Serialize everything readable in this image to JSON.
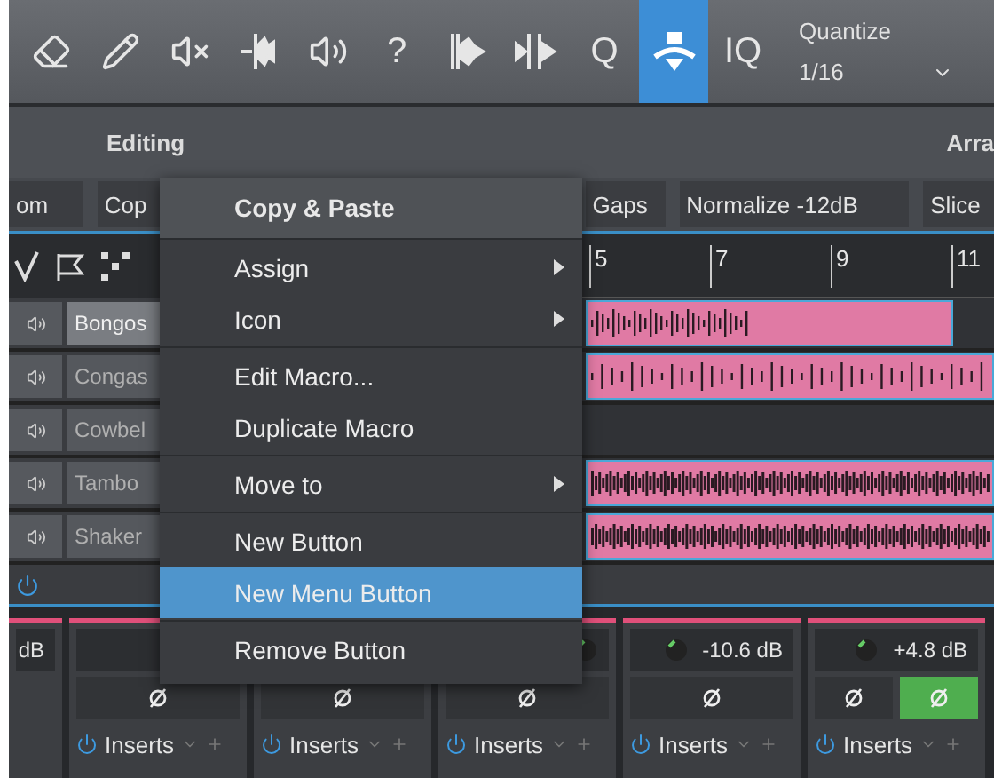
{
  "toolbar": {
    "tools": [
      {
        "kind": "eraser",
        "selected": false
      },
      {
        "kind": "pencil",
        "selected": false
      },
      {
        "kind": "mute",
        "selected": false
      },
      {
        "kind": "split",
        "selected": false
      },
      {
        "kind": "speaker",
        "selected": false
      },
      {
        "kind": "text",
        "label": "?",
        "selected": false
      },
      {
        "kind": "bend",
        "selected": false
      },
      {
        "kind": "stretch",
        "selected": false
      },
      {
        "kind": "text",
        "label": "Q",
        "selected": false
      },
      {
        "kind": "macro",
        "selected": true
      },
      {
        "kind": "text",
        "label": "IQ",
        "selected": false
      }
    ],
    "quantize": {
      "label": "Quantize",
      "value": "1/16"
    }
  },
  "editing": {
    "title": "Editing",
    "right_title": "Arra"
  },
  "macros": [
    "om",
    "Cop",
    "Gaps",
    "Normalize -12dB",
    "Slice"
  ],
  "ruler": {
    "marks": [
      "5",
      "7",
      "9",
      "11"
    ]
  },
  "tracks": [
    {
      "name": "Bongos",
      "selected": true,
      "kind": "short"
    },
    {
      "name": "Congas",
      "selected": false,
      "kind": "sparse"
    },
    {
      "name": "Cowbel",
      "selected": false,
      "kind": "empty"
    },
    {
      "name": "Tambo",
      "selected": false,
      "kind": "dense"
    },
    {
      "name": "Shaker",
      "selected": false,
      "kind": "dense"
    }
  ],
  "mixer": [
    {
      "kind": "partial",
      "value": "dB"
    },
    {
      "kind": "full",
      "phase": [
        {
          "on": false
        }
      ],
      "inserts": "Inserts"
    },
    {
      "kind": "full",
      "phase": [
        {
          "on": false
        }
      ],
      "inserts": "Inserts"
    },
    {
      "kind": "full",
      "phase": [
        {
          "on": false
        }
      ],
      "inserts": "Inserts"
    },
    {
      "kind": "full",
      "value": "-10.6 dB",
      "phase": [
        {
          "on": false
        }
      ],
      "inserts": "Inserts"
    },
    {
      "kind": "full",
      "value": "+4.8 dB",
      "phase": [
        {
          "on": false
        },
        {
          "on": true
        }
      ],
      "inserts": "Inserts"
    }
  ],
  "context_menu": {
    "title": "Copy & Paste",
    "groups": [
      [
        {
          "label": "Assign",
          "submenu": true,
          "selected": false
        },
        {
          "label": "Icon",
          "submenu": true,
          "selected": false
        }
      ],
      [
        {
          "label": "Edit Macro...",
          "submenu": false,
          "selected": false
        },
        {
          "label": "Duplicate Macro",
          "submenu": false,
          "selected": false
        }
      ],
      [
        {
          "label": "Move to",
          "submenu": true,
          "selected": false
        }
      ],
      [
        {
          "label": "New Button",
          "submenu": false,
          "selected": false
        },
        {
          "label": "New Menu Button",
          "submenu": false,
          "selected": true
        }
      ],
      [
        {
          "label": "Remove Button",
          "submenu": false,
          "selected": false
        }
      ]
    ]
  }
}
